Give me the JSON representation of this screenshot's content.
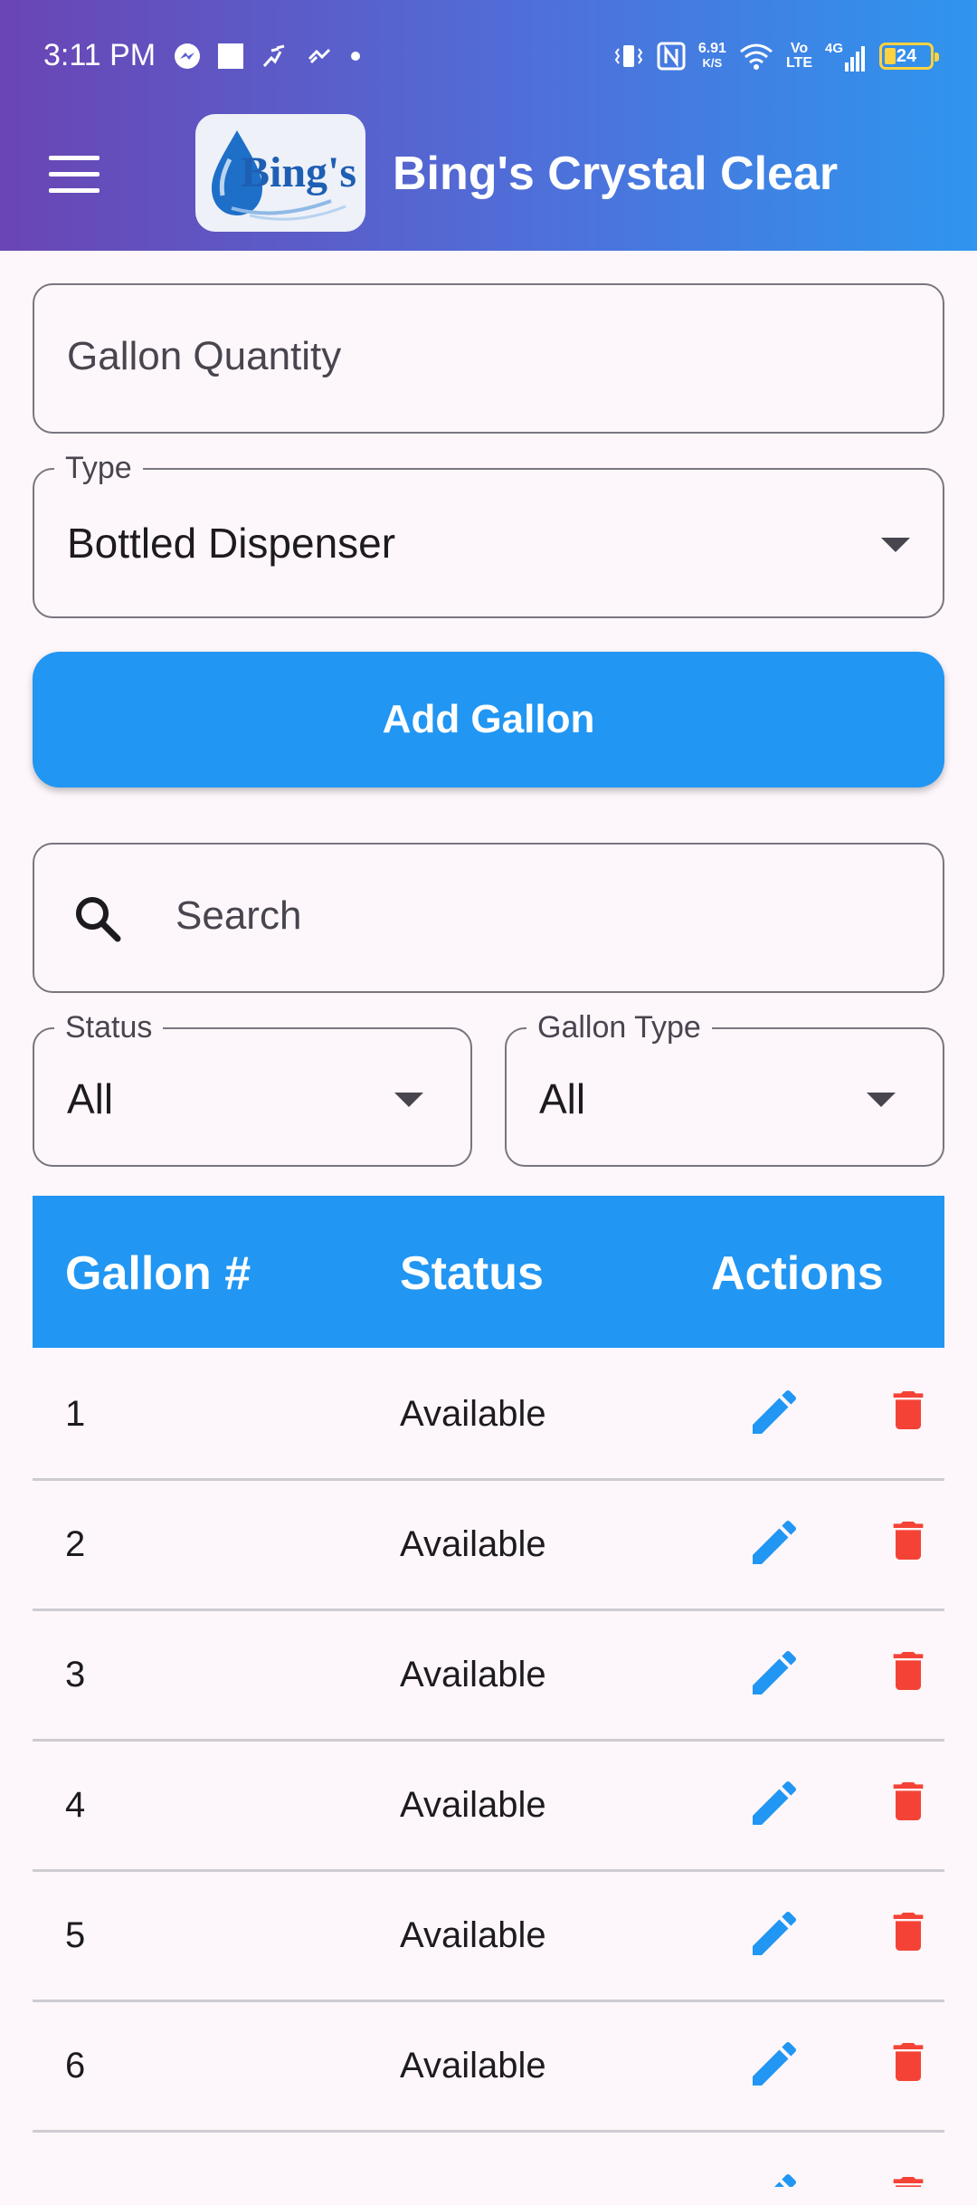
{
  "status_bar": {
    "time": "3:11 PM",
    "net_speed_value": "6.91",
    "net_speed_unit": "K/S",
    "volte_top": "Vo",
    "volte_bottom": "LTE",
    "signal": "4G",
    "battery": "24"
  },
  "app_bar": {
    "logo_text": "Bing's",
    "title": "Bing's Crystal Clear"
  },
  "form": {
    "quantity_placeholder": "Gallon Quantity",
    "type_label": "Type",
    "type_value": "Bottled Dispenser",
    "add_button": "Add Gallon"
  },
  "filters": {
    "search_placeholder": "Search",
    "status_label": "Status",
    "status_value": "All",
    "gallon_type_label": "Gallon Type",
    "gallon_type_value": "All"
  },
  "table": {
    "headers": [
      "Gallon #",
      "Status",
      "Actions"
    ],
    "rows": [
      {
        "number": "1",
        "status": "Available"
      },
      {
        "number": "2",
        "status": "Available"
      },
      {
        "number": "3",
        "status": "Available"
      },
      {
        "number": "4",
        "status": "Available"
      },
      {
        "number": "5",
        "status": "Available"
      },
      {
        "number": "6",
        "status": "Available"
      }
    ]
  },
  "colors": {
    "accent": "#2196f3",
    "delete": "#f44336",
    "gradient_start": "#6a45b4",
    "gradient_end": "#2f95ee"
  }
}
